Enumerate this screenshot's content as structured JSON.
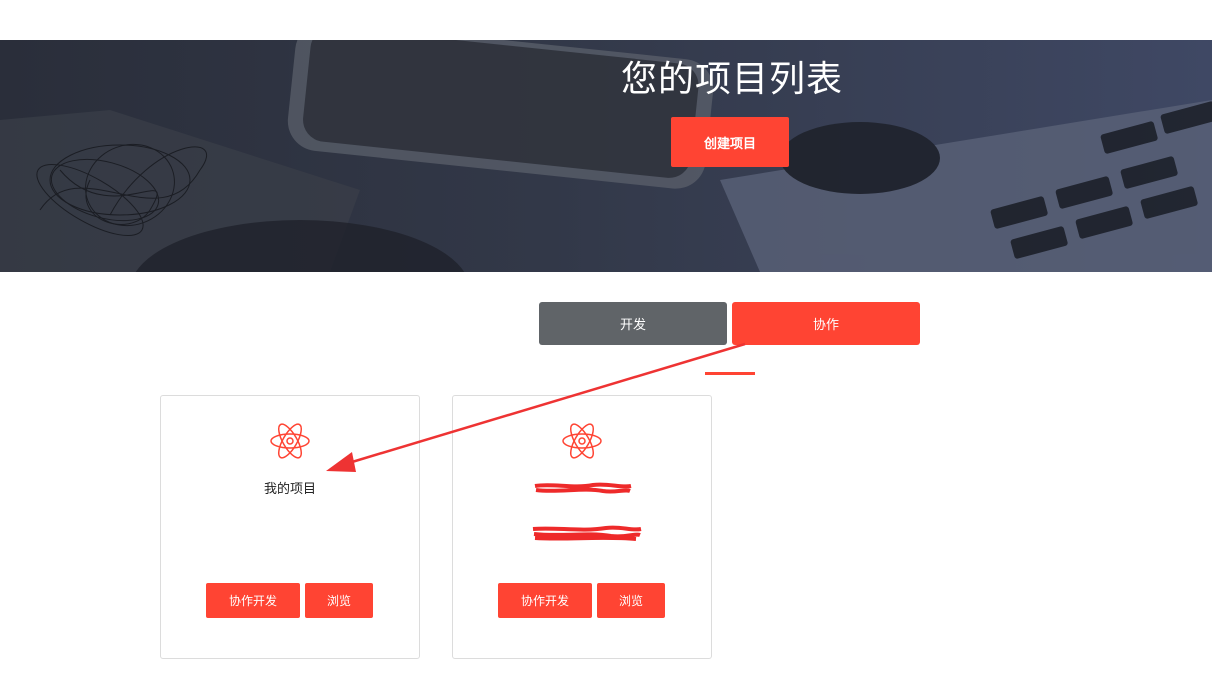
{
  "hero": {
    "title": "您的项目列表",
    "create_button": "创建项目"
  },
  "tabs": [
    {
      "label": "开发",
      "active": false
    },
    {
      "label": "协作",
      "active": true
    }
  ],
  "projects": [
    {
      "name": "我的项目",
      "redacted": false,
      "primary_action": "协作开发",
      "secondary_action": "浏览"
    },
    {
      "name": "",
      "redacted": true,
      "primary_action": "协作开发",
      "secondary_action": "浏览"
    }
  ],
  "colors": {
    "accent": "#ff4433",
    "tab_inactive": "#606468",
    "hero_dark": "#2a2e3a"
  },
  "icons": {
    "project": "atom-icon"
  }
}
